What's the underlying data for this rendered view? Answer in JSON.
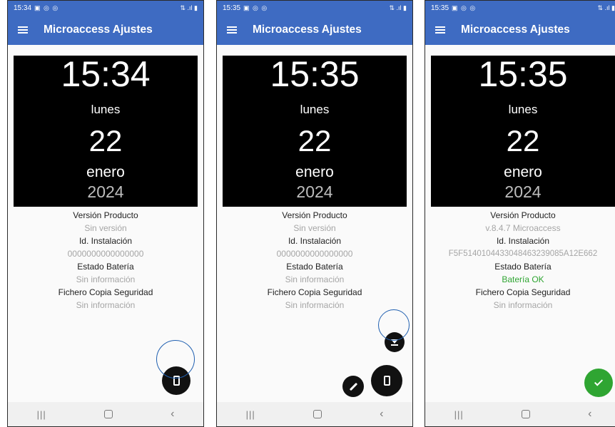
{
  "app": {
    "title": "Microaccess Ajustes"
  },
  "screens": [
    {
      "status": {
        "time": "15:34",
        "icons": "▣ ◎ ◎",
        "right": "⇅ .ıl ▮"
      },
      "clock": {
        "time": "15:34",
        "weekday": "lunes",
        "day": "22",
        "month": "enero",
        "year": "2024"
      },
      "info": {
        "version_label": "Versión Producto",
        "version_value": "Sin versión",
        "install_label": "Id. Instalación",
        "install_value": "0000000000000000",
        "battery_label": "Estado Batería",
        "battery_value": "Sin información",
        "backup_label": "Fichero Copia Seguridad",
        "backup_value": "Sin información"
      }
    },
    {
      "status": {
        "time": "15:35",
        "icons": "▣ ◎ ◎",
        "right": "⇅ .ıl ▮"
      },
      "clock": {
        "time": "15:35",
        "weekday": "lunes",
        "day": "22",
        "month": "enero",
        "year": "2024"
      },
      "info": {
        "version_label": "Versión Producto",
        "version_value": "Sin versión",
        "install_label": "Id. Instalación",
        "install_value": "0000000000000000",
        "battery_label": "Estado Batería",
        "battery_value": "Sin información",
        "backup_label": "Fichero Copia Seguridad",
        "backup_value": "Sin información"
      }
    },
    {
      "status": {
        "time": "15:35",
        "icons": "▣ ◎ ◎",
        "right": "⇅ .ıl ▮"
      },
      "clock": {
        "time": "15:35",
        "weekday": "lunes",
        "day": "22",
        "month": "enero",
        "year": "2024"
      },
      "info": {
        "version_label": "Versión Producto",
        "version_value": "v.8.4.7 Microaccess",
        "install_label": "Id. Instalación",
        "install_value": "F5F5140104433048463239085A12E662",
        "battery_label": "Estado Batería",
        "battery_value": "Batería OK",
        "backup_label": "Fichero Copia Seguridad",
        "backup_value": "Sin información"
      }
    }
  ],
  "nav": {
    "recents": "|||",
    "back": "‹"
  },
  "icons": {
    "menu": "menu-icon",
    "phone": "smartphone-icon",
    "pencil": "pencil-icon",
    "download": "download-icon",
    "check": "check-icon"
  },
  "colors": {
    "app_bar": "#3e6bc2",
    "clock_bg": "#000000",
    "fab_black": "#111111",
    "fab_green": "#2fa532",
    "battery_ok": "#2fa532",
    "highlight": "#1f5fb0"
  }
}
